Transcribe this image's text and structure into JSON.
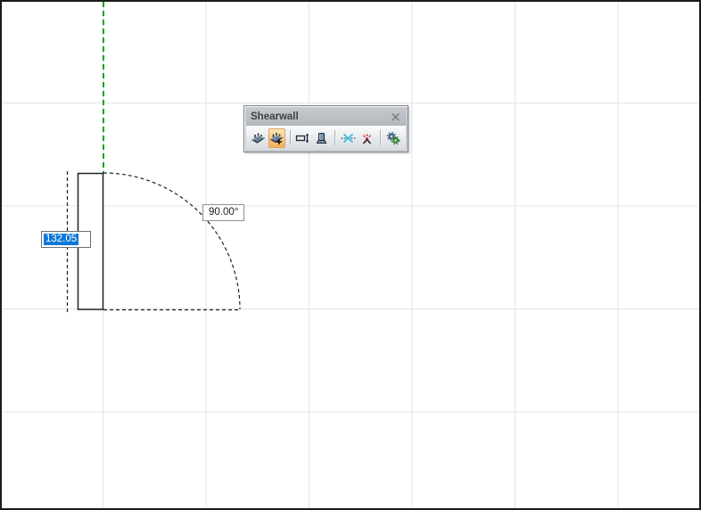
{
  "window": {
    "background": "#ffffff",
    "border_color": "#1b1b1b",
    "grid_color": "#e3e3ea"
  },
  "toolbar": {
    "title": "Shearwall",
    "close_label": "×",
    "buttons": [
      {
        "name": "draw-shearwall",
        "selected": false
      },
      {
        "name": "add-shearwall",
        "selected": true
      },
      {
        "name": "wall-dimension",
        "selected": false
      },
      {
        "name": "pedestal",
        "selected": false
      },
      {
        "name": "snap-node",
        "selected": false
      },
      {
        "name": "break-node",
        "selected": false
      },
      {
        "name": "settings-gears",
        "selected": false
      }
    ]
  },
  "canvas": {
    "angle_label": "90.00°",
    "length_value": "132.05",
    "guide_color": "#12a312",
    "selection_color": "#0a78d7",
    "sketch_color": "#1c212b"
  }
}
